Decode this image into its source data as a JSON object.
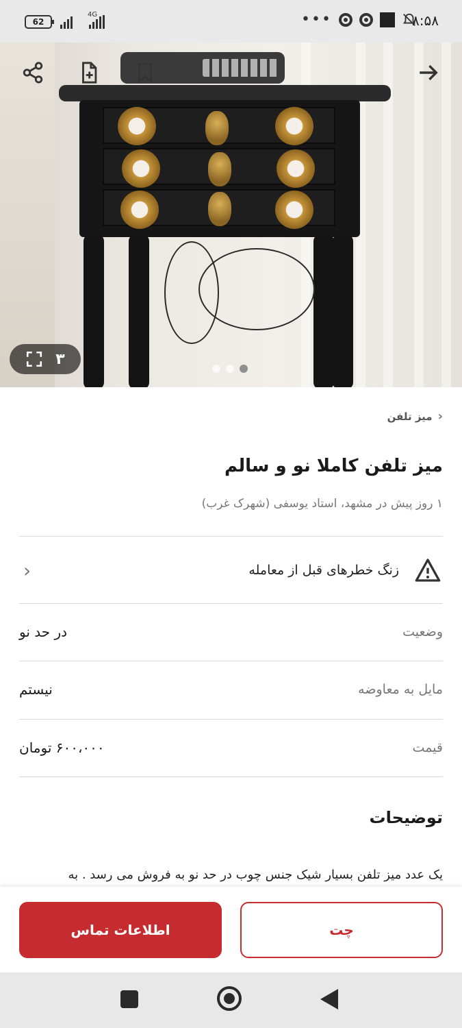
{
  "status_bar": {
    "time": "۸:۵۸",
    "battery": "62",
    "network": "4G"
  },
  "gallery": {
    "image_count": "۳",
    "pages": 3,
    "active_page": 3
  },
  "breadcrumb": "میز تلفن",
  "listing": {
    "title": "میز تلفن کاملا نو و سالم",
    "meta": "۱ روز پیش در مشهد، استاد یوسفی (شهرک غرب)"
  },
  "warning": {
    "label": "زنگ خطرهای قبل از معامله"
  },
  "details": [
    {
      "key": "وضعیت",
      "value": "در حد نو"
    },
    {
      "key": "مایل به معاوضه",
      "value": "نیستم"
    },
    {
      "key": "قیمت",
      "value": "۶۰۰،۰۰۰ تومان"
    }
  ],
  "description": {
    "heading": "توضیحات",
    "text": "یک عدد میز تلفن بسیار شیک جنس چوب در حد نو به فروش می رسد . به"
  },
  "actions": {
    "chat": "چت",
    "contact": "اطلاعات تماس"
  },
  "colors": {
    "brand_red": "#c62b2f"
  }
}
